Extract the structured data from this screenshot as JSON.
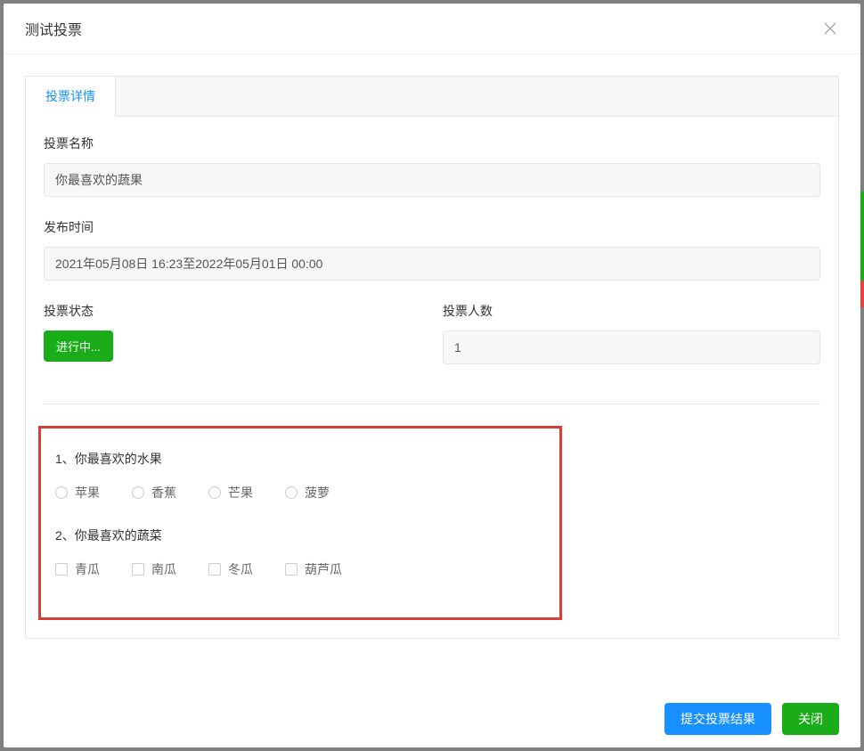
{
  "modal": {
    "title": "测试投票"
  },
  "tab": {
    "label": "投票详情"
  },
  "fields": {
    "voteName": {
      "label": "投票名称",
      "value": "你最喜欢的蔬果"
    },
    "publishTime": {
      "label": "发布时间",
      "value": "2021年05月08日 16:23至2022年05月01日 00:00"
    },
    "voteStatus": {
      "label": "投票状态",
      "badge": "进行中..."
    },
    "voteCount": {
      "label": "投票人数",
      "value": "1"
    }
  },
  "questions": [
    {
      "title": "1、你最喜欢的水果",
      "type": "radio",
      "options": [
        "苹果",
        "香蕉",
        "芒果",
        "菠萝"
      ]
    },
    {
      "title": "2、你最喜欢的蔬菜",
      "type": "checkbox",
      "options": [
        "青瓜",
        "南瓜",
        "冬瓜",
        "葫芦瓜"
      ]
    }
  ],
  "footer": {
    "submit": "提交投票结果",
    "close": "关闭"
  }
}
